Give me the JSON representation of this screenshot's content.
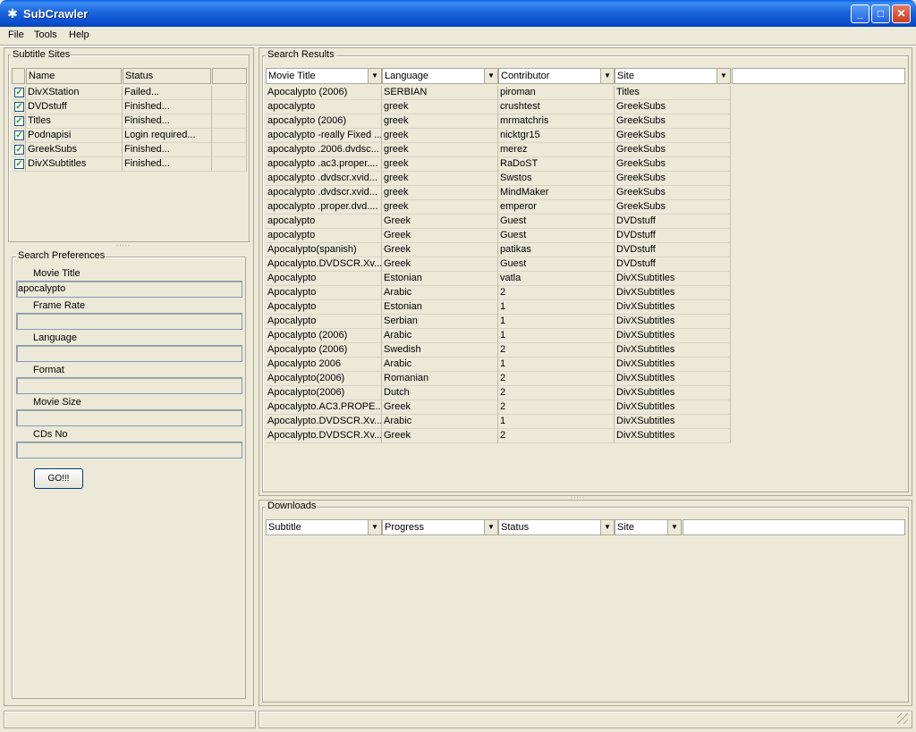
{
  "window": {
    "title": "SubCrawler"
  },
  "menu": [
    "File",
    "Tools",
    "Help"
  ],
  "sites_panel": {
    "title": "Subtitle Sites",
    "columns": [
      "Name",
      "Status"
    ],
    "rows": [
      {
        "checked": true,
        "name": "DivXStation",
        "status": "Failed..."
      },
      {
        "checked": true,
        "name": "DVDstuff",
        "status": "Finished..."
      },
      {
        "checked": true,
        "name": "Titles",
        "status": "Finished..."
      },
      {
        "checked": true,
        "name": "Podnapisi",
        "status": "Login required..."
      },
      {
        "checked": true,
        "name": "GreekSubs",
        "status": "Finished..."
      },
      {
        "checked": true,
        "name": "DivXSubtitles",
        "status": "Finished..."
      }
    ]
  },
  "prefs": {
    "title": "Search Preferences",
    "fields": [
      {
        "label": "Movie Title",
        "value": "apocalypto"
      },
      {
        "label": "Frame Rate",
        "value": ""
      },
      {
        "label": "Language",
        "value": ""
      },
      {
        "label": "Format",
        "value": ""
      },
      {
        "label": "Movie Size",
        "value": ""
      },
      {
        "label": "CDs No",
        "value": ""
      }
    ],
    "go_label": "GO!!!"
  },
  "results": {
    "title": "Search Results",
    "columns": [
      "Movie Title",
      "Language",
      "Contributor",
      "Site"
    ],
    "rows": [
      [
        "Apocalypto (2006)",
        "SERBIAN",
        "piroman",
        "Titles"
      ],
      [
        "apocalypto",
        "greek",
        "crushtest",
        "GreekSubs"
      ],
      [
        "apocalypto (2006)",
        "greek",
        "mrmatchris",
        "GreekSubs"
      ],
      [
        "apocalypto -really Fixed ...",
        "greek",
        "nicktgr15",
        "GreekSubs"
      ],
      [
        "apocalypto .2006.dvdsc...",
        "greek",
        "merez",
        "GreekSubs"
      ],
      [
        "apocalypto .ac3.proper....",
        "greek",
        "RaDoST",
        "GreekSubs"
      ],
      [
        "apocalypto .dvdscr.xvid...",
        "greek",
        "Swstos",
        "GreekSubs"
      ],
      [
        "apocalypto .dvdscr.xvid...",
        "greek",
        "MindMaker",
        "GreekSubs"
      ],
      [
        "apocalypto .proper.dvd....",
        "greek",
        "emperor",
        "GreekSubs"
      ],
      [
        "apocalypto",
        "Greek",
        "Guest",
        "DVDstuff"
      ],
      [
        "apocalypto",
        "Greek",
        "Guest",
        "DVDstuff"
      ],
      [
        "Apocalypto(spanish)",
        "Greek",
        "patikas",
        "DVDstuff"
      ],
      [
        "Apocalypto.DVDSCR.Xv...",
        "Greek",
        "Guest",
        "DVDstuff"
      ],
      [
        "Apocalypto",
        "Estonian",
        "vatla",
        "DivXSubtitles"
      ],
      [
        "Apocalypto",
        "Arabic",
        "2",
        "DivXSubtitles"
      ],
      [
        "Apocalypto",
        "Estonian",
        "1",
        "DivXSubtitles"
      ],
      [
        "Apocalypto",
        "Serbian",
        "1",
        "DivXSubtitles"
      ],
      [
        "Apocalypto (2006)",
        "Arabic",
        "1",
        "DivXSubtitles"
      ],
      [
        "Apocalypto (2006)",
        "Swedish",
        "2",
        "DivXSubtitles"
      ],
      [
        "Apocalypto 2006",
        "Arabic",
        "1",
        "DivXSubtitles"
      ],
      [
        "Apocalypto(2006)",
        "Romanian",
        "2",
        "DivXSubtitles"
      ],
      [
        "Apocalypto(2006)",
        "Dutch",
        "2",
        "DivXSubtitles"
      ],
      [
        "Apocalypto.AC3.PROPE...",
        "Greek",
        "2",
        "DivXSubtitles"
      ],
      [
        "Apocalypto.DVDSCR.Xv...",
        "Arabic",
        "1",
        "DivXSubtitles"
      ],
      [
        "Apocalypto.DVDSCR.Xv...",
        "Greek",
        "2",
        "DivXSubtitles"
      ]
    ]
  },
  "downloads": {
    "title": "Downloads",
    "columns": [
      "Subtitle",
      "Progress",
      "Status",
      "Site"
    ]
  },
  "icons": {
    "app": "spider-icon",
    "dropdown": "chevron-down-icon",
    "checkbox": "check-icon"
  }
}
